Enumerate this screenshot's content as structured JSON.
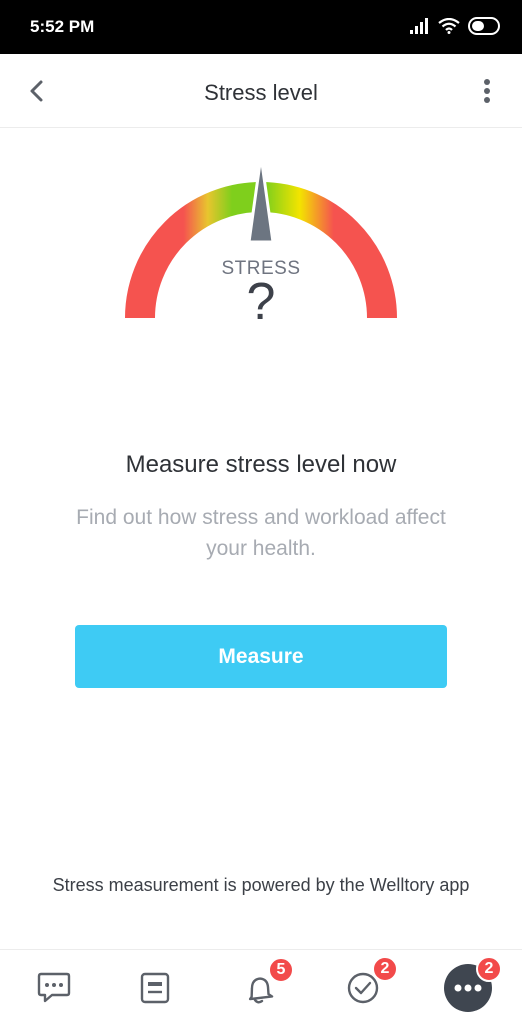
{
  "status_bar": {
    "time": "5:52 PM",
    "signal_icon": "signal-icon",
    "wifi_icon": "wifi-icon",
    "battery_icon": "battery-icon"
  },
  "header": {
    "title": "Stress level",
    "back_icon": "chevron-left-icon",
    "menu_icon": "more-vertical-icon"
  },
  "gauge": {
    "label": "STRESS",
    "value": "?",
    "colors": [
      "#f5534f",
      "#e8c52e",
      "#7fcf1c",
      "#f3e400",
      "#f5534f"
    ],
    "needle_color": "#6c7581"
  },
  "content": {
    "headline": "Measure stress level now",
    "subtext": "Find out how stress and workload affect your health.",
    "button_label": "Measure"
  },
  "footer_note": "Stress measurement is powered by the Welltory app",
  "bottom_nav": {
    "items": [
      {
        "name": "chat-icon",
        "badge": ""
      },
      {
        "name": "document-icon",
        "badge": ""
      },
      {
        "name": "bell-icon",
        "badge": "5"
      },
      {
        "name": "check-circle-icon",
        "badge": "2"
      },
      {
        "name": "more-horizontal-icon",
        "badge": "2"
      }
    ]
  },
  "colors": {
    "accent": "#3ecbf4",
    "badge": "#f24a4a",
    "text": "#2f3237",
    "muted": "#a7abb2"
  }
}
